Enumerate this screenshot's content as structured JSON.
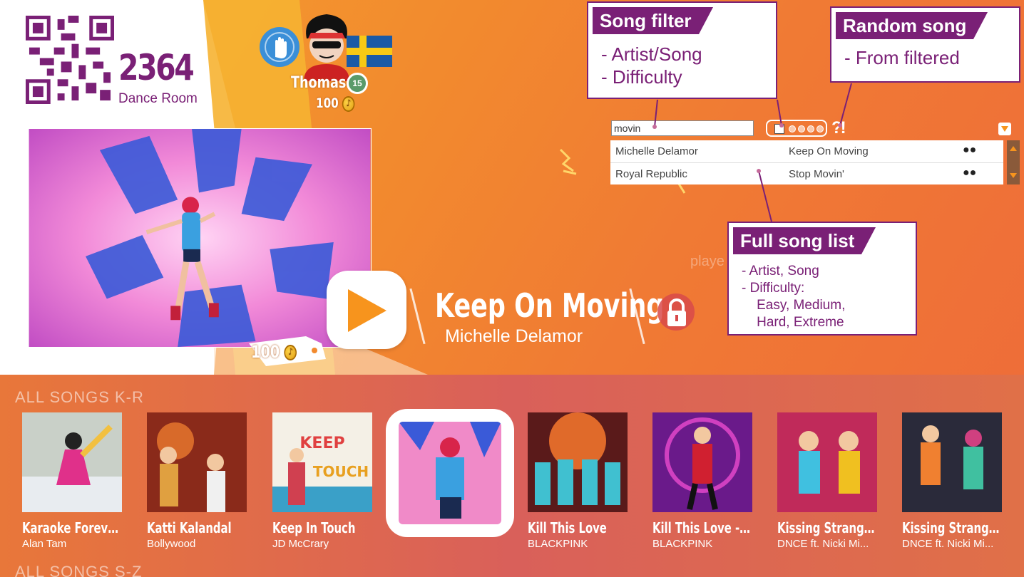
{
  "room": {
    "number": "2364",
    "label": "Dance Room",
    "qr_icon": "qr-code-icon"
  },
  "player": {
    "name": "Thomas",
    "level": "15",
    "coins": "100",
    "flag": "sweden-flag-icon",
    "hand_icon": "hand-wave-icon"
  },
  "selected_song": {
    "title": "Keep On Moving",
    "artist": "Michelle Delamor",
    "price": "100",
    "watermark": "playe"
  },
  "filter": {
    "search_value": "movin",
    "random_label": "?!"
  },
  "song_list": [
    {
      "artist": "Michelle Delamor",
      "song": "Keep On Moving",
      "difficulty": "●●"
    },
    {
      "artist": "Royal Republic",
      "song": "Stop Movin'",
      "difficulty": "●●"
    }
  ],
  "annotations": {
    "filter": {
      "title": "Song filter",
      "body": "- Artist/Song\n- Difficulty"
    },
    "random": {
      "title": "Random song",
      "body": "- From filtered"
    },
    "full_list": {
      "title": "Full song list",
      "body": "- Artist, Song\n- Difficulty:\n    Easy, Medium,\n    Hard, Extreme"
    }
  },
  "carousel": {
    "category": "ALL SONGS K-R",
    "next_category": "ALL SONGS S-Z",
    "cards": [
      {
        "title": "Karaoke Forever ...",
        "artist": "Alan Tam"
      },
      {
        "title": "Katti Kalandal",
        "artist": "Bollywood"
      },
      {
        "title": "Keep In Touch",
        "artist": "JD McCrary"
      },
      {
        "title": "",
        "artist": ""
      },
      {
        "title": "Kill This Love",
        "artist": "BLACKPINK"
      },
      {
        "title": "Kill This Love - A...",
        "artist": "BLACKPINK"
      },
      {
        "title": "Kissing Strangers",
        "artist": "DNCE ft. Nicki Mi..."
      },
      {
        "title": "Kissing Stranger...",
        "artist": "DNCE ft. Nicki Mi..."
      }
    ]
  },
  "colors": {
    "accent": "#7a2076",
    "orange": "#f7941d"
  }
}
